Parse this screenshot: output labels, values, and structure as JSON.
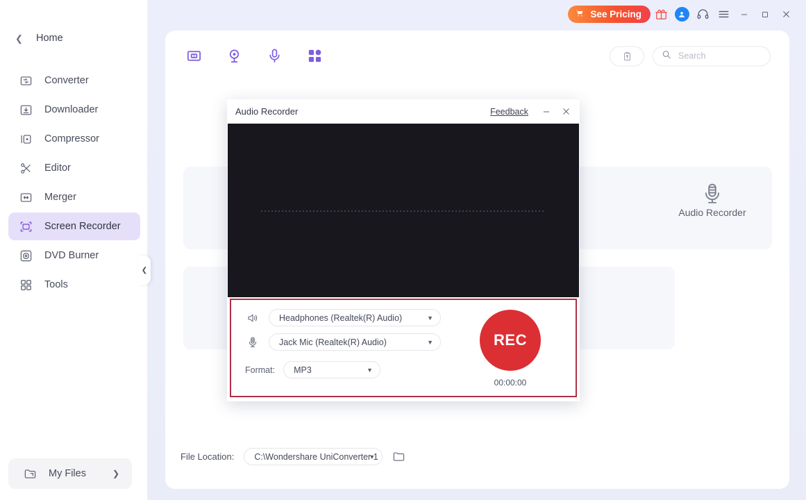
{
  "header": {
    "pricing_label": "See Pricing",
    "icons": [
      "cart-icon",
      "gift-icon",
      "user-avatar-icon",
      "headset-icon",
      "hamburger-menu-icon"
    ],
    "window_controls": [
      "minimize",
      "maximize",
      "close"
    ],
    "pricing_gradient_from": "#fb8a3c",
    "pricing_gradient_to": "#f2414a",
    "avatar_color": "#2186f5"
  },
  "sidebar": {
    "home_label": "Home",
    "items": [
      {
        "label": "Converter",
        "icon": "converter-icon"
      },
      {
        "label": "Downloader",
        "icon": "downloader-icon"
      },
      {
        "label": "Compressor",
        "icon": "compressor-icon"
      },
      {
        "label": "Editor",
        "icon": "editor-icon"
      },
      {
        "label": "Merger",
        "icon": "merger-icon"
      },
      {
        "label": "Screen Recorder",
        "icon": "screen-recorder-icon"
      },
      {
        "label": "DVD Burner",
        "icon": "dvd-burner-icon"
      },
      {
        "label": "Tools",
        "icon": "tools-icon"
      }
    ],
    "active_item": "Screen Recorder",
    "active_bg": "#e6dffa",
    "accent": "#7b52d8",
    "my_files_label": "My Files"
  },
  "toolbar": {
    "icons": [
      "screen-recorder-tool-icon",
      "webcam-recorder-tool-icon",
      "audio-recorder-tool-icon",
      "apps-grid-tool-icon"
    ],
    "clipboard_icon": "clipboard-icon",
    "search_placeholder": "Search",
    "search_value": ""
  },
  "background_cards": {
    "audio_card_label": "Audio Recorder",
    "audio_card_icon": "microphone-icon",
    "card_bg": "#f6f7fb"
  },
  "dialog": {
    "title": "Audio Recorder",
    "feedback_label": "Feedback",
    "minimize_label": "–",
    "close_label": "×",
    "waveform_bg": "#17171d",
    "highlight_border_color": "#ae2f46",
    "speaker": {
      "icon": "speaker-icon",
      "value": "Headphones (Realtek(R) Audio)"
    },
    "microphone": {
      "icon": "microphone-icon",
      "value": "Jack Mic (Realtek(R) Audio)"
    },
    "format": {
      "label": "Format:",
      "value": "MP3"
    },
    "record": {
      "label": "REC",
      "timer": "00:00:00",
      "color": "#dc2f34"
    }
  },
  "file_location": {
    "label": "File Location:",
    "value": "C:\\Wondershare UniConverter 1",
    "folder_icon": "folder-icon"
  }
}
